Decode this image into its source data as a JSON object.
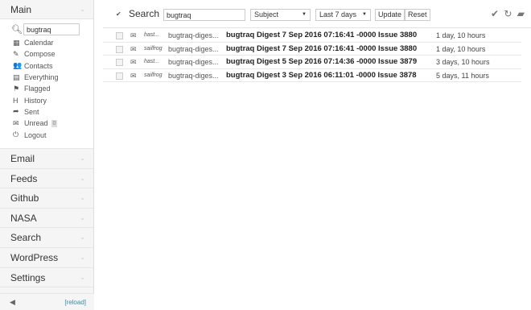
{
  "sidebar": {
    "main_label": "Main",
    "search_value": "bugtraq",
    "items": [
      {
        "icon": "calendar-icon",
        "glyph": "▦",
        "label": "Calendar"
      },
      {
        "icon": "compose-icon",
        "glyph": "✎",
        "label": "Compose"
      },
      {
        "icon": "contacts-icon",
        "glyph": "👥",
        "label": "Contacts"
      },
      {
        "icon": "everything-icon",
        "glyph": "▤",
        "label": "Everything"
      },
      {
        "icon": "flag-icon",
        "glyph": "⚑",
        "label": "Flagged"
      },
      {
        "icon": "history-icon",
        "glyph": "H",
        "label": "History"
      },
      {
        "icon": "sent-icon",
        "glyph": "➦",
        "label": "Sent"
      },
      {
        "icon": "unread-icon",
        "glyph": "✉",
        "label": "Unread",
        "badge": "0"
      },
      {
        "icon": "logout-icon",
        "glyph": "⏻",
        "label": "Logout"
      }
    ],
    "sections": [
      "Email",
      "Feeds",
      "Github",
      "NASA",
      "Search",
      "WordPress",
      "Settings"
    ],
    "reload_label": "[reload]"
  },
  "toolbar": {
    "search_label": "Search",
    "search_value": "bugtraq",
    "field_select": "Subject",
    "date_select": "Last 7 days",
    "update_label": "Update",
    "reset_label": "Reset"
  },
  "messages": [
    {
      "from": "hast...",
      "to": "bugtraq-diges...",
      "subject": "bugtraq Digest 7 Sep 2016 07:16:41 -0000 Issue 3880",
      "date": "1 day, 10 hours"
    },
    {
      "from": "sailfrog",
      "to": "bugtraq-diges...",
      "subject": "bugtraq Digest 7 Sep 2016 07:16:41 -0000 Issue 3880",
      "date": "1 day, 10 hours"
    },
    {
      "from": "hast...",
      "to": "bugtraq-diges...",
      "subject": "bugtraq Digest 5 Sep 2016 07:14:36 -0000 Issue 3879",
      "date": "3 days, 10 hours"
    },
    {
      "from": "sailfrog",
      "to": "bugtraq-diges...",
      "subject": "bugtraq Digest 3 Sep 2016 06:11:01 -0000 Issue 3878",
      "date": "5 days, 11 hours"
    }
  ]
}
